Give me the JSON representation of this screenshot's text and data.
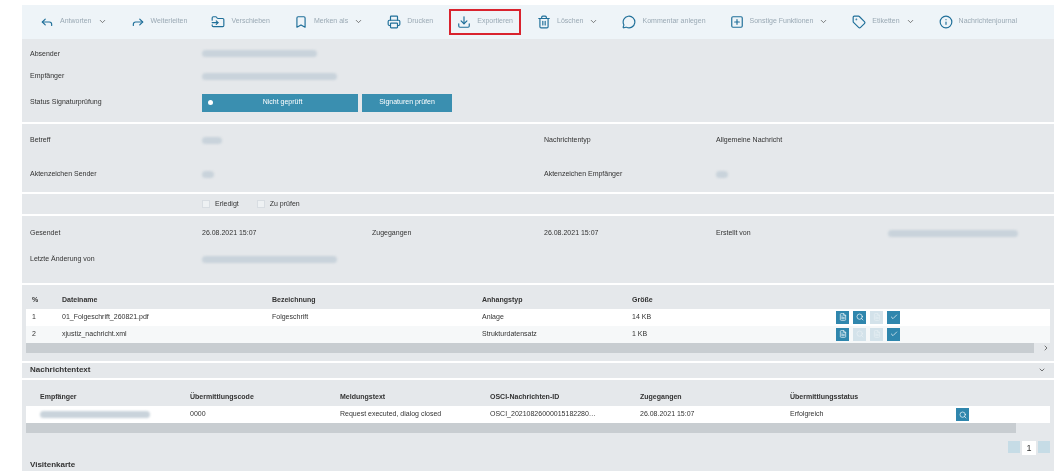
{
  "toolbar": [
    {
      "kind": "reply",
      "label": "Antworten",
      "dropdown": true,
      "highlighted": false
    },
    {
      "kind": "forward",
      "label": "Weiterleiten",
      "dropdown": false,
      "highlighted": false
    },
    {
      "kind": "folder",
      "label": "Verschieben",
      "dropdown": false,
      "highlighted": false
    },
    {
      "kind": "bookmark",
      "label": "Merken als",
      "dropdown": true,
      "highlighted": false
    },
    {
      "kind": "print",
      "label": "Drucken",
      "dropdown": false,
      "highlighted": false
    },
    {
      "kind": "download",
      "label": "Exportieren",
      "dropdown": false,
      "highlighted": true
    },
    {
      "kind": "trash",
      "label": "Löschen",
      "dropdown": true,
      "highlighted": false
    },
    {
      "kind": "comment",
      "label": "Kommentar anlegen",
      "dropdown": false,
      "highlighted": false
    },
    {
      "kind": "plus",
      "label": "Sonstige Funktionen",
      "dropdown": true,
      "highlighted": false
    },
    {
      "kind": "tag",
      "label": "Etiketten",
      "dropdown": true,
      "highlighted": false
    },
    {
      "kind": "info",
      "label": "Nachrichtenjournal",
      "dropdown": false,
      "highlighted": false
    }
  ],
  "header": {
    "sender_label": "Absender",
    "recipient_label": "Empfänger",
    "status_label": "Status Signaturprüfung",
    "status_button": "Nicht geprüft",
    "check_button": "Signaturen prüfen"
  },
  "details": [
    {
      "label": "Betreff",
      "label2": "Nachrichtentyp",
      "value2": "Allgemeine Nachricht"
    },
    {
      "label": "Aktenzeichen Sender",
      "label2": "Aktenzeichen Empfänger"
    }
  ],
  "flags": [
    {
      "label": "Erledigt",
      "checked": false
    },
    {
      "label": "Zu prüfen",
      "checked": false
    }
  ],
  "dates": {
    "sent_label": "Gesendet",
    "sent": "26.08.2021 15:07",
    "received_label": "Zugegangen",
    "received": "26.08.2021 15:07",
    "created_label": "Erstellt von",
    "changed_label": "Letzte Änderung von"
  },
  "attachments": {
    "columns": [
      "%",
      "Dateiname",
      "Bezeichnung",
      "Anhangstyp",
      "Größe"
    ],
    "rows": [
      {
        "cells": [
          "1",
          "01_Folgeschrift_260821.pdf",
          "Folgeschrift",
          "Anlage",
          "14 KB"
        ],
        "actions": [
          true,
          true,
          false,
          true
        ]
      },
      {
        "cells": [
          "2",
          "xjustiz_nachricht.xml",
          "",
          "Strukturdatensatz",
          "1 KB"
        ],
        "actions": [
          true,
          false,
          false,
          true
        ]
      }
    ]
  },
  "message_text": {
    "title": "Nachrichtentext",
    "expanded": false
  },
  "transmissions": {
    "columns": [
      "Empfänger",
      "Übermittlungscode",
      "Meldungstext",
      "OSCI-Nachrichten-ID",
      "Zugegangen",
      "Übermittlungsstatus"
    ],
    "rows": [
      {
        "cells": [
          "",
          "0000",
          "Request executed, dialog closed",
          "OSCI_20210826000015182280…",
          "26.08.2021 15:07",
          "Erfolgreich"
        ]
      }
    ]
  },
  "pagination": {
    "page": "1"
  },
  "footer_title": "Visitenkarte"
}
